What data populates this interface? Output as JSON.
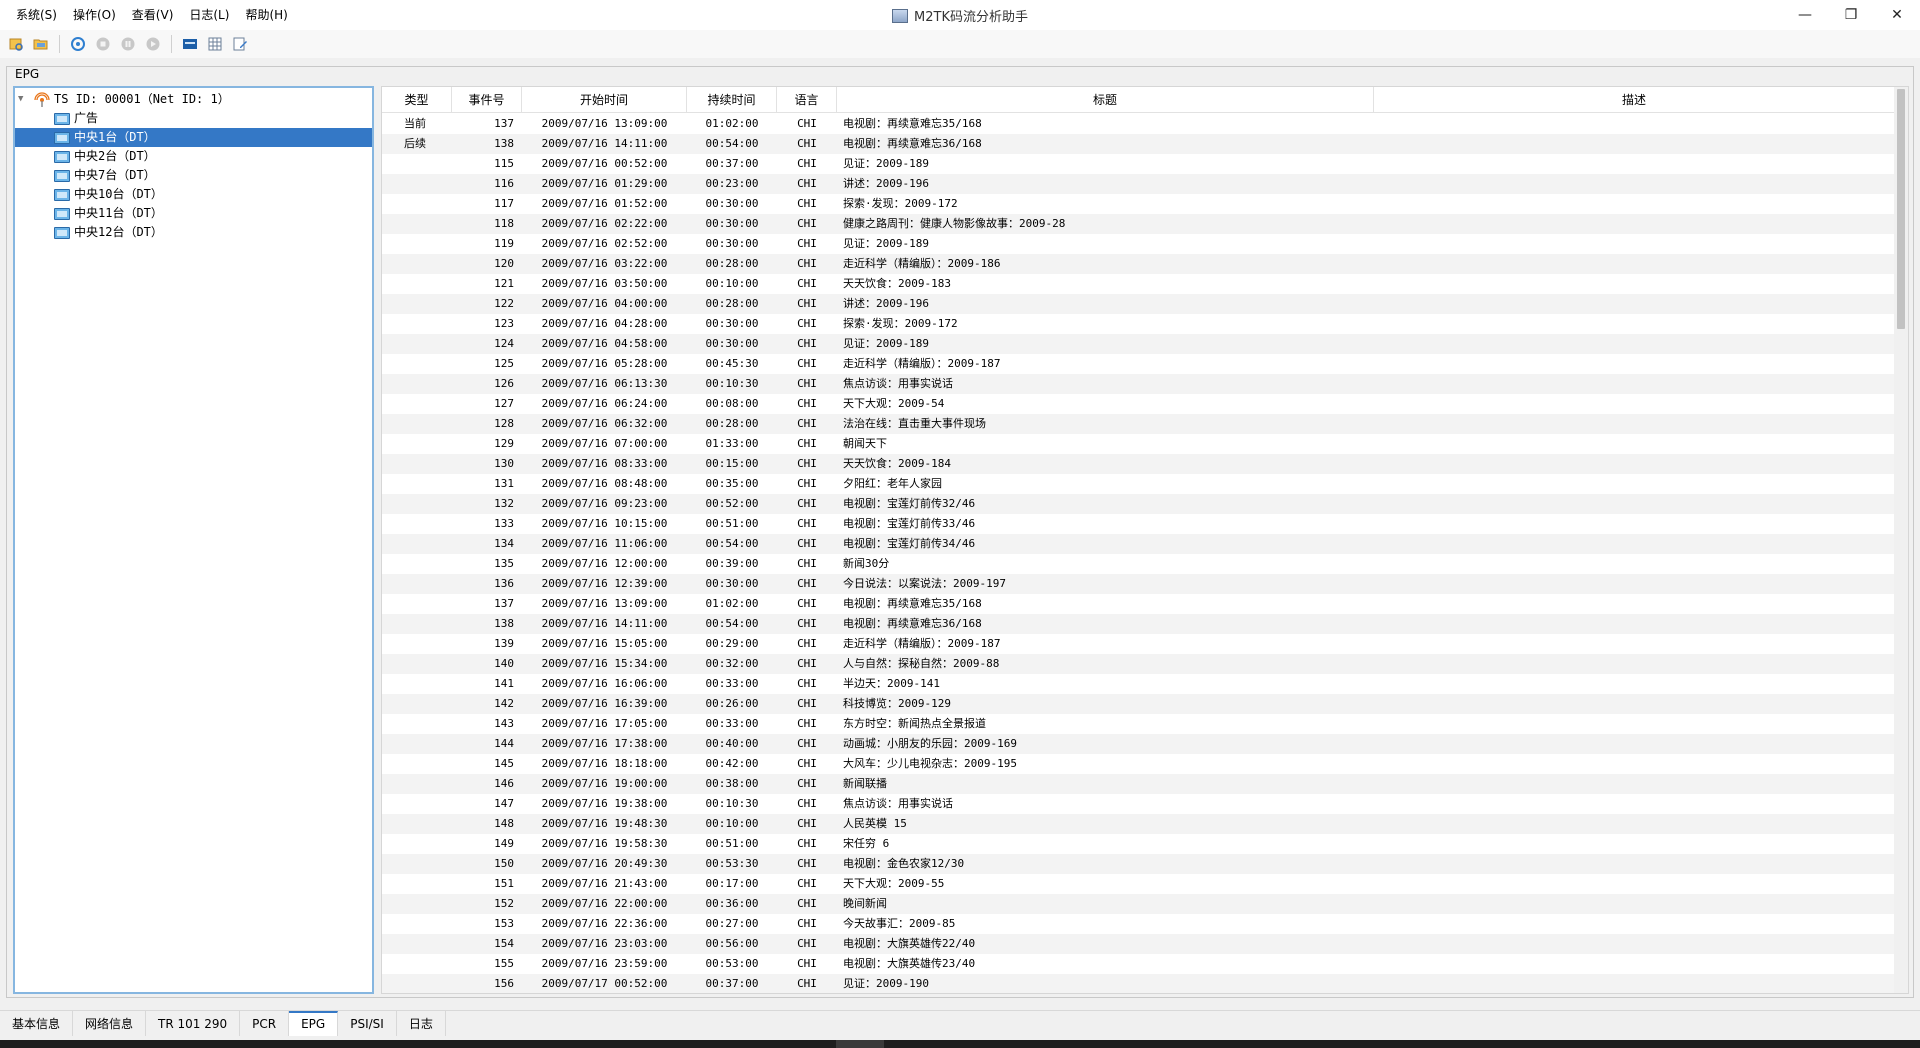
{
  "window": {
    "title": "M2TK码流分析助手",
    "controls": [
      "—",
      "❐",
      "✕"
    ]
  },
  "menu": [
    "系统(S)",
    "操作(O)",
    "查看(V)",
    "日志(L)",
    "帮助(H)"
  ],
  "toolbar_icons": [
    "open-file-icon",
    "open-folder-icon",
    "refresh-icon",
    "stop-icon",
    "pause-icon",
    "play-icon",
    "console-icon",
    "table-icon",
    "edit-icon"
  ],
  "group_label": "EPG",
  "tree": {
    "root": "TS ID: 00001（Net ID: 1）",
    "children": [
      "广告",
      "中央1台（DT）",
      "中央2台（DT）",
      "中央7台（DT）",
      "中央10台（DT）",
      "中央11台（DT）",
      "中央12台（DT）"
    ],
    "selected_index": 1
  },
  "table": {
    "headers": [
      "类型",
      "事件号",
      "开始时间",
      "持续时间",
      "语言",
      "标题",
      "描述"
    ],
    "rows": [
      {
        "type": "当前",
        "id": "137",
        "start": "2009/07/16 13:09:00",
        "dur": "01:02:00",
        "lang": "CHI",
        "title": "电视剧：再续意难忘35/168",
        "desc": ""
      },
      {
        "type": "后续",
        "id": "138",
        "start": "2009/07/16 14:11:00",
        "dur": "00:54:00",
        "lang": "CHI",
        "title": "电视剧：再续意难忘36/168",
        "desc": ""
      },
      {
        "type": "",
        "id": "115",
        "start": "2009/07/16 00:52:00",
        "dur": "00:37:00",
        "lang": "CHI",
        "title": "见证：2009-189",
        "desc": ""
      },
      {
        "type": "",
        "id": "116",
        "start": "2009/07/16 01:29:00",
        "dur": "00:23:00",
        "lang": "CHI",
        "title": "讲述：2009-196",
        "desc": ""
      },
      {
        "type": "",
        "id": "117",
        "start": "2009/07/16 01:52:00",
        "dur": "00:30:00",
        "lang": "CHI",
        "title": "探索·发现：2009-172",
        "desc": ""
      },
      {
        "type": "",
        "id": "118",
        "start": "2009/07/16 02:22:00",
        "dur": "00:30:00",
        "lang": "CHI",
        "title": "健康之路周刊：健康人物影像故事：2009-28",
        "desc": ""
      },
      {
        "type": "",
        "id": "119",
        "start": "2009/07/16 02:52:00",
        "dur": "00:30:00",
        "lang": "CHI",
        "title": "见证：2009-189",
        "desc": ""
      },
      {
        "type": "",
        "id": "120",
        "start": "2009/07/16 03:22:00",
        "dur": "00:28:00",
        "lang": "CHI",
        "title": "走近科学（精编版）：2009-186",
        "desc": ""
      },
      {
        "type": "",
        "id": "121",
        "start": "2009/07/16 03:50:00",
        "dur": "00:10:00",
        "lang": "CHI",
        "title": "天天饮食：2009-183",
        "desc": ""
      },
      {
        "type": "",
        "id": "122",
        "start": "2009/07/16 04:00:00",
        "dur": "00:28:00",
        "lang": "CHI",
        "title": "讲述：2009-196",
        "desc": ""
      },
      {
        "type": "",
        "id": "123",
        "start": "2009/07/16 04:28:00",
        "dur": "00:30:00",
        "lang": "CHI",
        "title": "探索·发现：2009-172",
        "desc": ""
      },
      {
        "type": "",
        "id": "124",
        "start": "2009/07/16 04:58:00",
        "dur": "00:30:00",
        "lang": "CHI",
        "title": "见证：2009-189",
        "desc": ""
      },
      {
        "type": "",
        "id": "125",
        "start": "2009/07/16 05:28:00",
        "dur": "00:45:30",
        "lang": "CHI",
        "title": "走近科学（精编版）：2009-187",
        "desc": ""
      },
      {
        "type": "",
        "id": "126",
        "start": "2009/07/16 06:13:30",
        "dur": "00:10:30",
        "lang": "CHI",
        "title": "焦点访谈：用事实说话",
        "desc": ""
      },
      {
        "type": "",
        "id": "127",
        "start": "2009/07/16 06:24:00",
        "dur": "00:08:00",
        "lang": "CHI",
        "title": "天下大观：2009-54",
        "desc": ""
      },
      {
        "type": "",
        "id": "128",
        "start": "2009/07/16 06:32:00",
        "dur": "00:28:00",
        "lang": "CHI",
        "title": "法治在线：直击重大事件现场",
        "desc": ""
      },
      {
        "type": "",
        "id": "129",
        "start": "2009/07/16 07:00:00",
        "dur": "01:33:00",
        "lang": "CHI",
        "title": "朝闻天下",
        "desc": ""
      },
      {
        "type": "",
        "id": "130",
        "start": "2009/07/16 08:33:00",
        "dur": "00:15:00",
        "lang": "CHI",
        "title": "天天饮食：2009-184",
        "desc": ""
      },
      {
        "type": "",
        "id": "131",
        "start": "2009/07/16 08:48:00",
        "dur": "00:35:00",
        "lang": "CHI",
        "title": "夕阳红：老年人家园",
        "desc": ""
      },
      {
        "type": "",
        "id": "132",
        "start": "2009/07/16 09:23:00",
        "dur": "00:52:00",
        "lang": "CHI",
        "title": "电视剧：宝莲灯前传32/46",
        "desc": ""
      },
      {
        "type": "",
        "id": "133",
        "start": "2009/07/16 10:15:00",
        "dur": "00:51:00",
        "lang": "CHI",
        "title": "电视剧：宝莲灯前传33/46",
        "desc": ""
      },
      {
        "type": "",
        "id": "134",
        "start": "2009/07/16 11:06:00",
        "dur": "00:54:00",
        "lang": "CHI",
        "title": "电视剧：宝莲灯前传34/46",
        "desc": ""
      },
      {
        "type": "",
        "id": "135",
        "start": "2009/07/16 12:00:00",
        "dur": "00:39:00",
        "lang": "CHI",
        "title": "新闻30分",
        "desc": ""
      },
      {
        "type": "",
        "id": "136",
        "start": "2009/07/16 12:39:00",
        "dur": "00:30:00",
        "lang": "CHI",
        "title": "今日说法：以案说法：2009-197",
        "desc": ""
      },
      {
        "type": "",
        "id": "137",
        "start": "2009/07/16 13:09:00",
        "dur": "01:02:00",
        "lang": "CHI",
        "title": "电视剧：再续意难忘35/168",
        "desc": ""
      },
      {
        "type": "",
        "id": "138",
        "start": "2009/07/16 14:11:00",
        "dur": "00:54:00",
        "lang": "CHI",
        "title": "电视剧：再续意难忘36/168",
        "desc": ""
      },
      {
        "type": "",
        "id": "139",
        "start": "2009/07/16 15:05:00",
        "dur": "00:29:00",
        "lang": "CHI",
        "title": "走近科学（精编版）：2009-187",
        "desc": ""
      },
      {
        "type": "",
        "id": "140",
        "start": "2009/07/16 15:34:00",
        "dur": "00:32:00",
        "lang": "CHI",
        "title": "人与自然：探秘自然：2009-88",
        "desc": ""
      },
      {
        "type": "",
        "id": "141",
        "start": "2009/07/16 16:06:00",
        "dur": "00:33:00",
        "lang": "CHI",
        "title": "半边天：2009-141",
        "desc": ""
      },
      {
        "type": "",
        "id": "142",
        "start": "2009/07/16 16:39:00",
        "dur": "00:26:00",
        "lang": "CHI",
        "title": "科技博览：2009-129",
        "desc": ""
      },
      {
        "type": "",
        "id": "143",
        "start": "2009/07/16 17:05:00",
        "dur": "00:33:00",
        "lang": "CHI",
        "title": "东方时空：新闻热点全景报道",
        "desc": ""
      },
      {
        "type": "",
        "id": "144",
        "start": "2009/07/16 17:38:00",
        "dur": "00:40:00",
        "lang": "CHI",
        "title": "动画城：小朋友的乐园：2009-169",
        "desc": ""
      },
      {
        "type": "",
        "id": "145",
        "start": "2009/07/16 18:18:00",
        "dur": "00:42:00",
        "lang": "CHI",
        "title": "大风车：少儿电视杂志：2009-195",
        "desc": ""
      },
      {
        "type": "",
        "id": "146",
        "start": "2009/07/16 19:00:00",
        "dur": "00:38:00",
        "lang": "CHI",
        "title": "新闻联播",
        "desc": ""
      },
      {
        "type": "",
        "id": "147",
        "start": "2009/07/16 19:38:00",
        "dur": "00:10:30",
        "lang": "CHI",
        "title": "焦点访谈：用事实说话",
        "desc": ""
      },
      {
        "type": "",
        "id": "148",
        "start": "2009/07/16 19:48:30",
        "dur": "00:10:00",
        "lang": "CHI",
        "title": "人民英模 15",
        "desc": ""
      },
      {
        "type": "",
        "id": "149",
        "start": "2009/07/16 19:58:30",
        "dur": "00:51:00",
        "lang": "CHI",
        "title": "宋任穷 6",
        "desc": ""
      },
      {
        "type": "",
        "id": "150",
        "start": "2009/07/16 20:49:30",
        "dur": "00:53:30",
        "lang": "CHI",
        "title": "电视剧：金色农家12/30",
        "desc": ""
      },
      {
        "type": "",
        "id": "151",
        "start": "2009/07/16 21:43:00",
        "dur": "00:17:00",
        "lang": "CHI",
        "title": "天下大观：2009-55",
        "desc": ""
      },
      {
        "type": "",
        "id": "152",
        "start": "2009/07/16 22:00:00",
        "dur": "00:36:00",
        "lang": "CHI",
        "title": "晚间新闻",
        "desc": ""
      },
      {
        "type": "",
        "id": "153",
        "start": "2009/07/16 22:36:00",
        "dur": "00:27:00",
        "lang": "CHI",
        "title": "今天故事汇：2009-85",
        "desc": ""
      },
      {
        "type": "",
        "id": "154",
        "start": "2009/07/16 23:03:00",
        "dur": "00:56:00",
        "lang": "CHI",
        "title": "电视剧：大旗英雄传22/40",
        "desc": ""
      },
      {
        "type": "",
        "id": "155",
        "start": "2009/07/16 23:59:00",
        "dur": "00:53:00",
        "lang": "CHI",
        "title": "电视剧：大旗英雄传23/40",
        "desc": ""
      },
      {
        "type": "",
        "id": "156",
        "start": "2009/07/17 00:52:00",
        "dur": "00:37:00",
        "lang": "CHI",
        "title": "见证：2009-190",
        "desc": ""
      }
    ]
  },
  "tabs": [
    "基本信息",
    "网络信息",
    "TR 101 290",
    "PCR",
    "EPG",
    "PSI/SI",
    "日志"
  ],
  "active_tab": "EPG",
  "colors": {
    "selection": "#3478c6",
    "tree_border": "#86b6e0"
  }
}
